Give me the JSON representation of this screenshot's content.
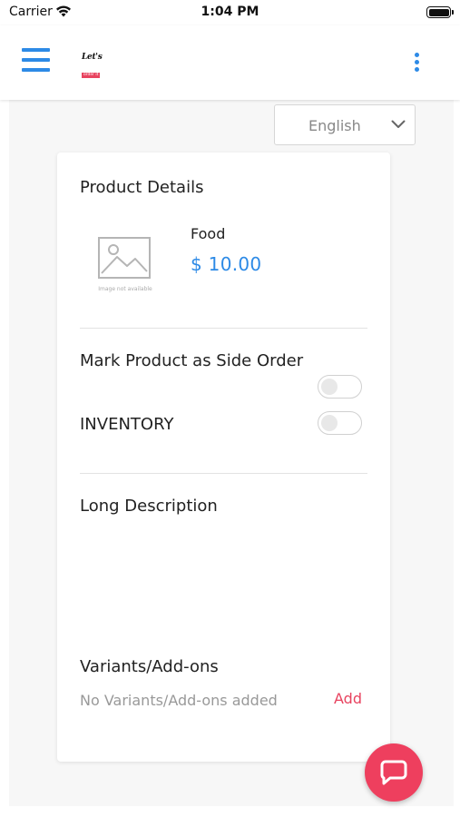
{
  "status_bar": {
    "carrier": "Carrier",
    "time": "1:04 PM",
    "icons": [
      "wifi-icon",
      "battery-icon"
    ]
  },
  "header": {
    "menu_icon": "hamburger-menu-icon",
    "logo": {
      "line1": "Let's",
      "line2": "order it"
    },
    "more_icon": "vertical-dots-icon",
    "accent_color": "#2d8ae6"
  },
  "language_select": {
    "selected": "English",
    "icon": "chevron-down-icon"
  },
  "card": {
    "title": "Product Details",
    "image_caption": "Image not available",
    "product_name": "Food",
    "product_price": "$ 10.00",
    "price_color": "#2d8ae6",
    "side_order_label": "Mark Product as Side Order",
    "side_order_on": false,
    "inventory_label": "INVENTORY",
    "inventory_on": false,
    "long_description_label": "Long Description",
    "variants_label": "Variants/Add-ons",
    "variants_empty": "No Variants/Add-ons added",
    "add_label": "Add",
    "add_color": "#e8435f"
  },
  "fab": {
    "icon": "chat-bubble-icon",
    "color": "#ee3f5e"
  }
}
